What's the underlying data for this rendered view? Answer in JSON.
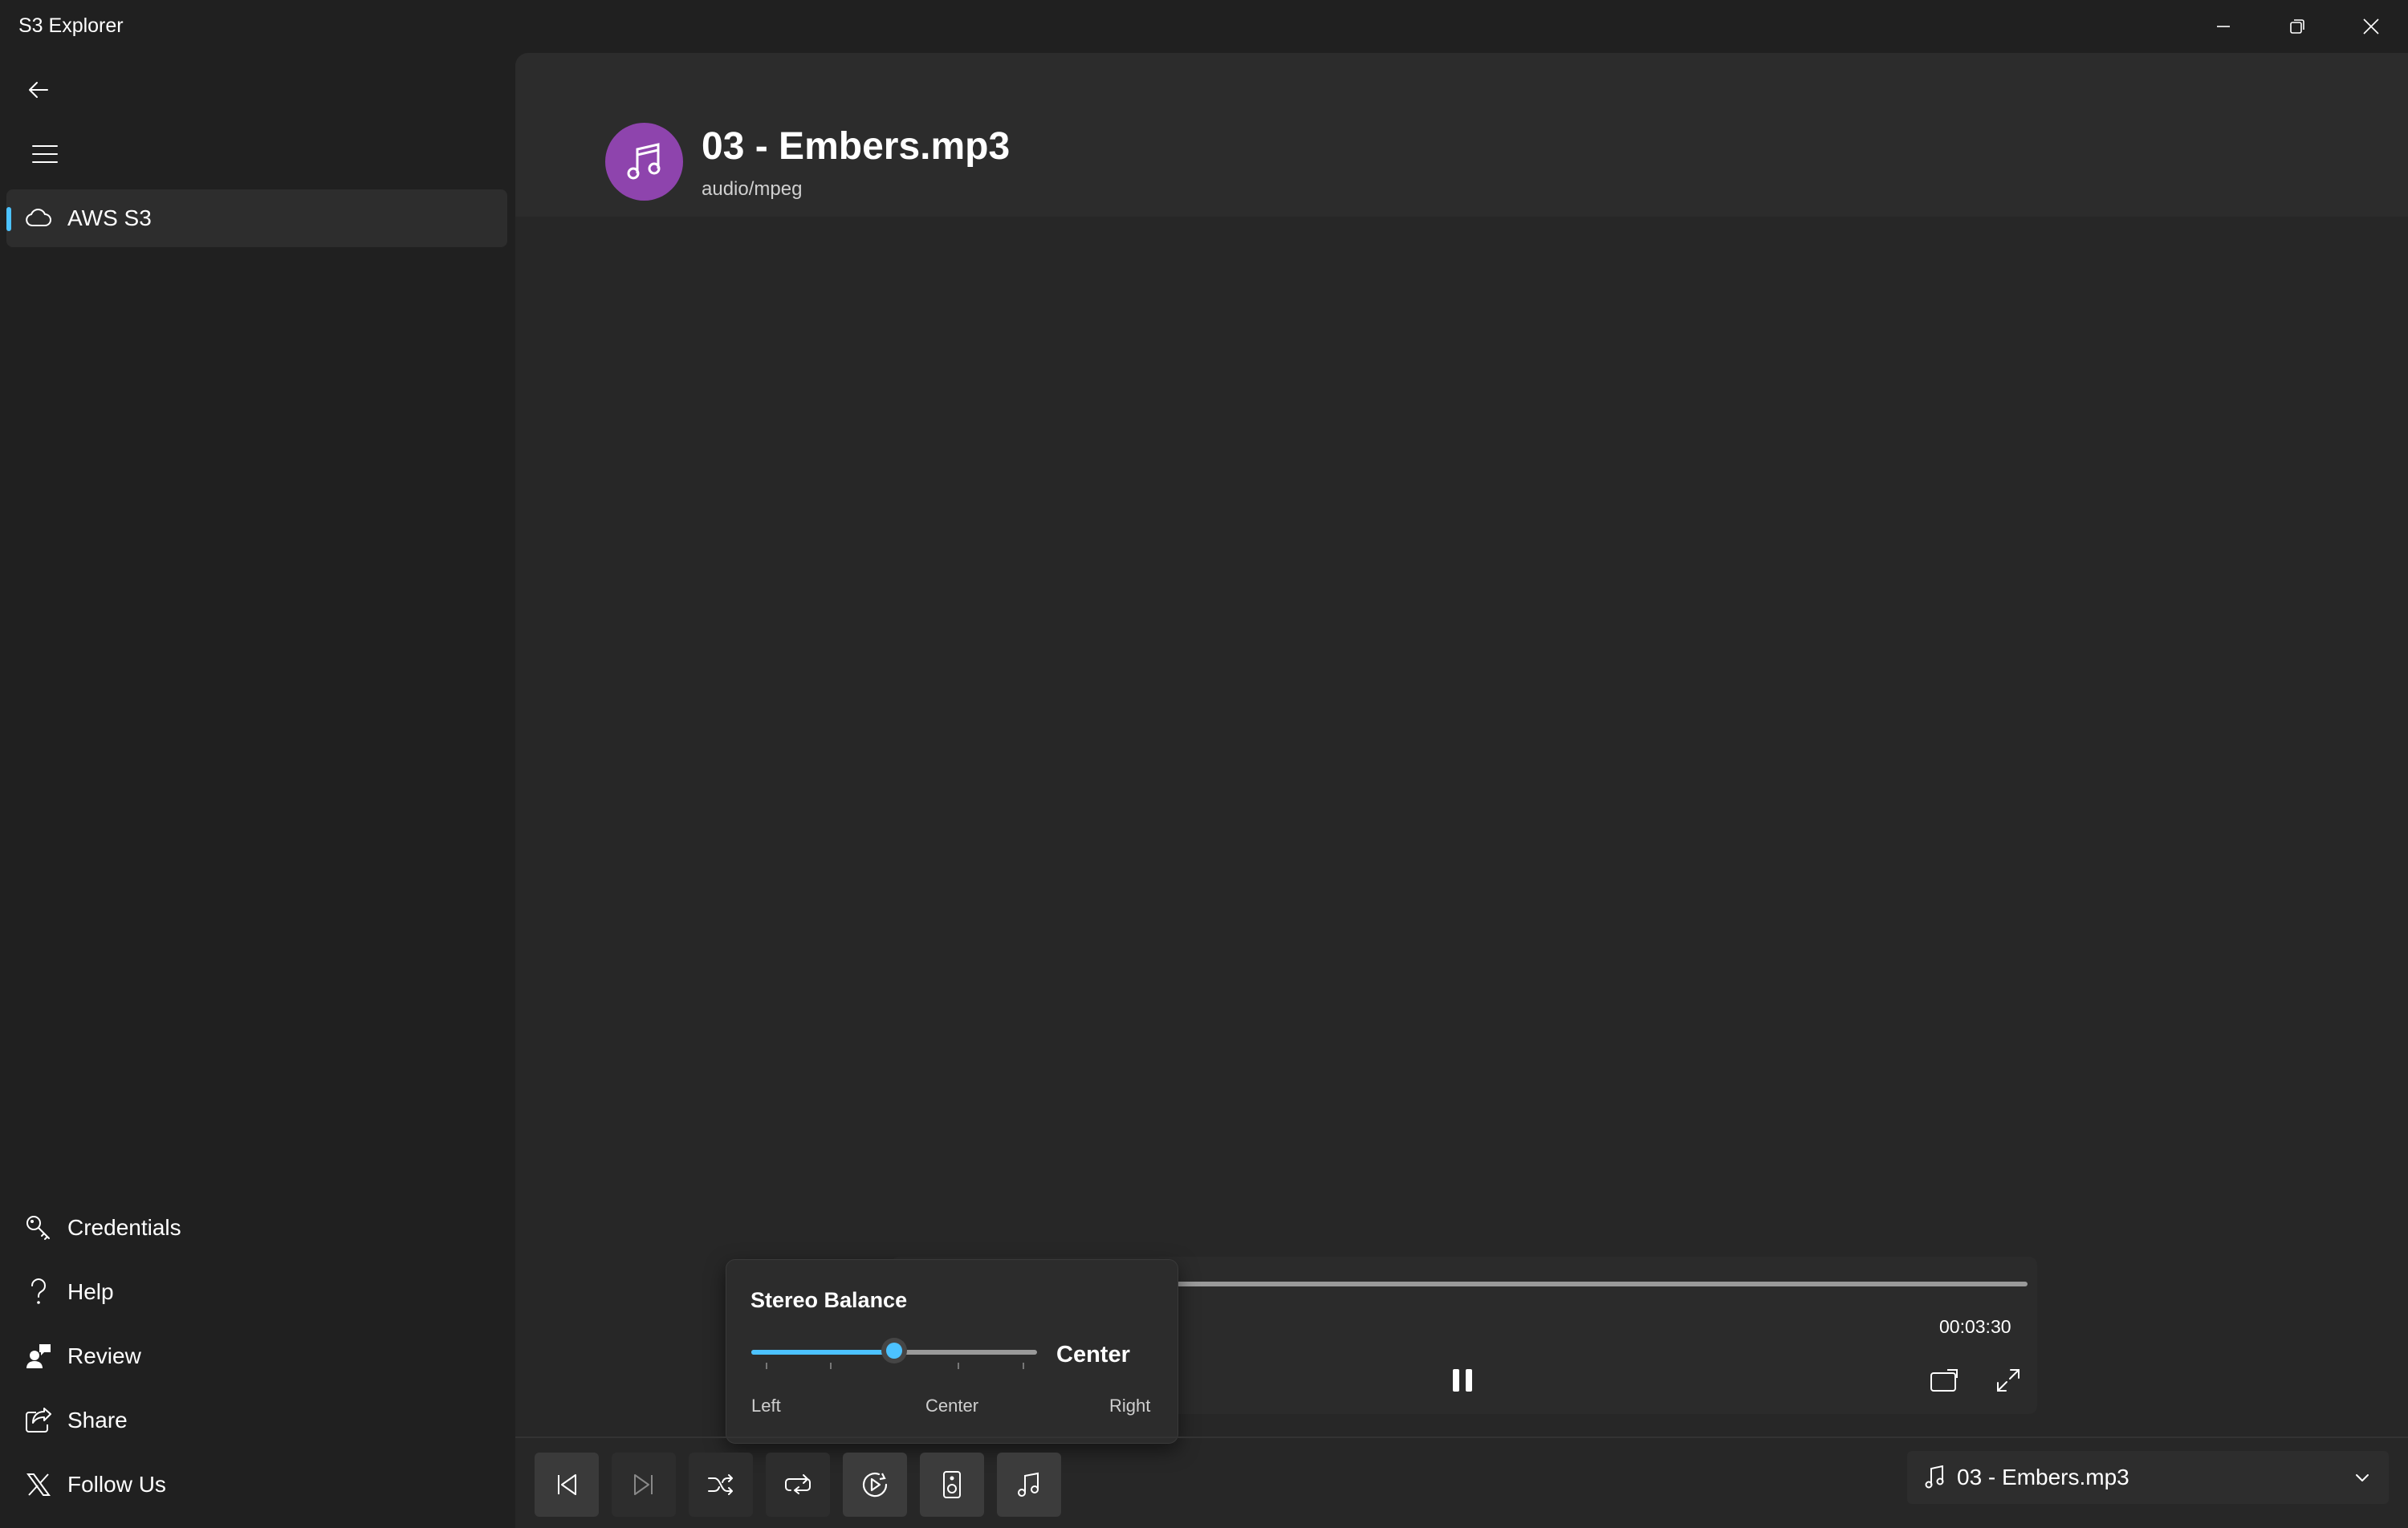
{
  "window": {
    "title": "S3 Explorer"
  },
  "sidebar": {
    "items": [
      {
        "label": "AWS S3",
        "icon": "cloud-icon",
        "selected": true
      }
    ],
    "footer": [
      {
        "label": "Credentials",
        "icon": "key-icon"
      },
      {
        "label": "Help",
        "icon": "question-icon"
      },
      {
        "label": "Review",
        "icon": "person-feedback-icon"
      },
      {
        "label": "Share",
        "icon": "share-icon"
      },
      {
        "label": "Follow Us",
        "icon": "x-logo-icon"
      }
    ]
  },
  "file": {
    "name": "03 - Embers.mp3",
    "mime": "audio/mpeg",
    "icon": "music-note-icon",
    "icon_color": "#8e44ad"
  },
  "player": {
    "duration": "00:03:30",
    "state": "playing"
  },
  "balance": {
    "title": "Stereo Balance",
    "value": "Center",
    "level": 0.5,
    "labels": {
      "left": "Left",
      "center": "Center",
      "right": "Right"
    }
  },
  "toolbar": {
    "buttons": [
      "previous-icon",
      "next-icon",
      "shuffle-icon",
      "repeat-icon",
      "speed-icon",
      "speaker-icon",
      "music-note-icon"
    ]
  },
  "track_select": {
    "value": "03 - Embers.mp3"
  },
  "colors": {
    "accent": "#4cc2ff",
    "background": "#202020",
    "surface": "#272727"
  }
}
